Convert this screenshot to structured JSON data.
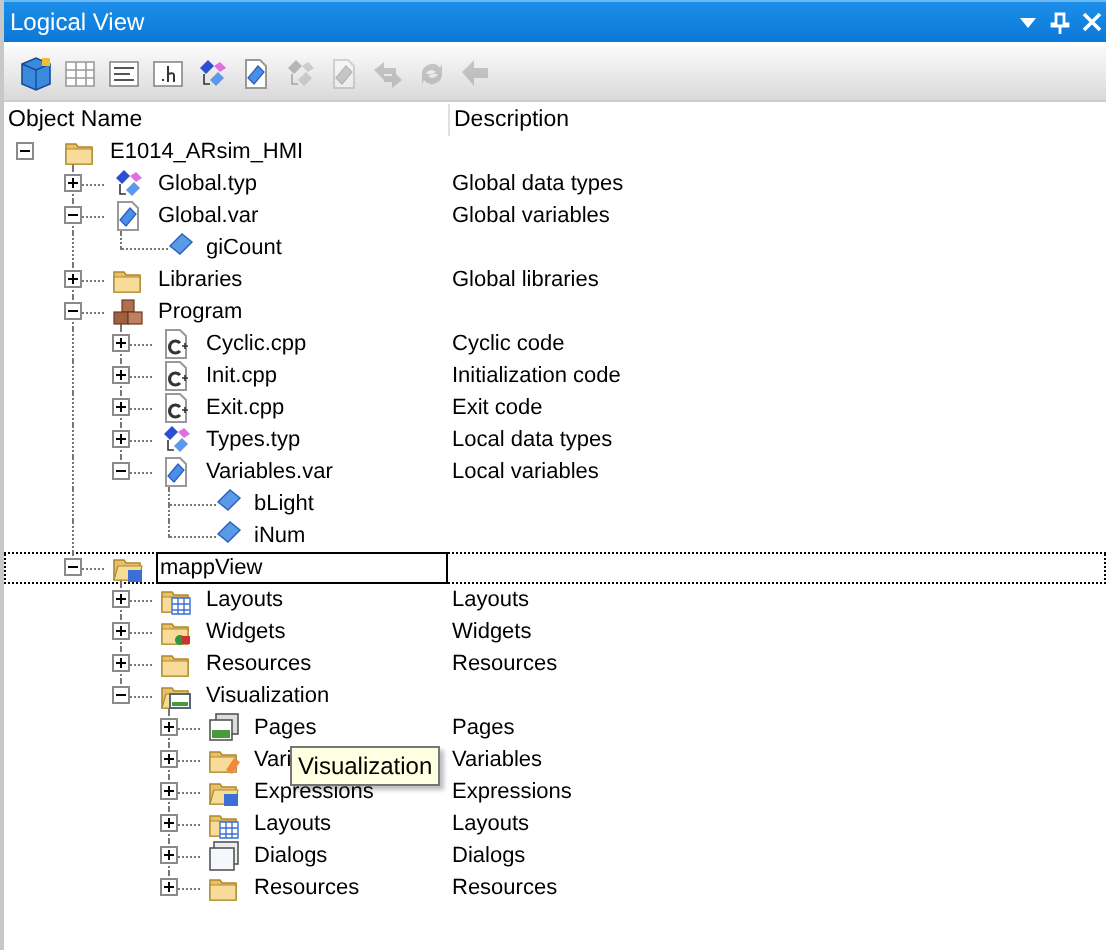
{
  "window": {
    "title": "Logical View"
  },
  "toolbar": [
    {
      "kind": "cube",
      "disabled": false
    },
    {
      "kind": "grid",
      "disabled": false
    },
    {
      "kind": "text",
      "disabled": false
    },
    {
      "kind": "header",
      "disabled": false
    },
    {
      "kind": "types",
      "disabled": false
    },
    {
      "kind": "var",
      "disabled": false
    },
    {
      "kind": "types",
      "disabled": true
    },
    {
      "kind": "var",
      "disabled": true
    },
    {
      "kind": "move",
      "disabled": true
    },
    {
      "kind": "cycle",
      "disabled": true
    },
    {
      "kind": "back",
      "disabled": true
    }
  ],
  "columns": [
    "Object Name",
    "Description"
  ],
  "tree": [
    {
      "name": "E1014_ARsim_HMI",
      "kind": "folder",
      "expanded": true,
      "focused": false,
      "children": [
        {
          "name": "Global.typ",
          "description": "Global data types",
          "kind": "types",
          "expanded": false,
          "focused": false
        },
        {
          "name": "Global.var",
          "description": "Global variables",
          "kind": "var",
          "expanded": true,
          "focused": false,
          "children": [
            {
              "name": "giCount",
              "kind": "variable",
              "focused": false
            }
          ]
        },
        {
          "name": "Libraries",
          "description": "Global libraries",
          "kind": "folder",
          "expanded": false,
          "focused": false
        },
        {
          "name": "Program",
          "kind": "program",
          "expanded": true,
          "focused": false,
          "children": [
            {
              "name": "Cyclic.cpp",
              "description": "Cyclic code",
              "kind": "cpp",
              "expanded": false,
              "focused": false
            },
            {
              "name": "Init.cpp",
              "description": "Initialization code",
              "kind": "cpp",
              "expanded": false,
              "focused": false
            },
            {
              "name": "Exit.cpp",
              "description": "Exit code",
              "kind": "cpp",
              "expanded": false,
              "focused": false
            },
            {
              "name": "Types.typ",
              "description": "Local data types",
              "kind": "types",
              "expanded": false,
              "focused": false
            },
            {
              "name": "Variables.var",
              "description": "Local variables",
              "kind": "var",
              "expanded": true,
              "focused": false,
              "children": [
                {
                  "name": "bLight",
                  "kind": "variable",
                  "focused": false
                },
                {
                  "name": "iNum",
                  "kind": "variable",
                  "focused": false
                }
              ]
            }
          ]
        },
        {
          "name": "mappView",
          "kind": "viewfolder",
          "expanded": true,
          "focused": true,
          "children": [
            {
              "name": "Layouts",
              "description": "Layouts",
              "kind": "layouts",
              "expanded": false,
              "focused": false
            },
            {
              "name": "Widgets",
              "description": "Widgets",
              "kind": "widgets",
              "expanded": false,
              "focused": false
            },
            {
              "name": "Resources",
              "description": "Resources",
              "kind": "folder",
              "expanded": false,
              "focused": false
            },
            {
              "name": "Visualization",
              "kind": "vizfolder",
              "expanded": true,
              "focused": false,
              "children": [
                {
                  "name": "Pages",
                  "description": "Pages",
                  "kind": "pages",
                  "expanded": false,
                  "focused": false
                },
                {
                  "name": "Vari",
                  "description": "Variables",
                  "kind": "varfolder",
                  "expanded": false,
                  "focused": false
                },
                {
                  "name": "Expressions",
                  "description": "Expressions",
                  "kind": "viewfolder",
                  "expanded": false,
                  "focused": false
                },
                {
                  "name": "Layouts",
                  "description": "Layouts",
                  "kind": "layouts",
                  "expanded": false,
                  "focused": false
                },
                {
                  "name": "Dialogs",
                  "description": "Dialogs",
                  "kind": "dialogs",
                  "expanded": false,
                  "focused": false
                },
                {
                  "name": "Resources",
                  "description": "Resources",
                  "kind": "folder",
                  "expanded": false,
                  "focused": false
                }
              ]
            }
          ]
        }
      ]
    }
  ],
  "tooltip": {
    "text": "Visualization"
  }
}
